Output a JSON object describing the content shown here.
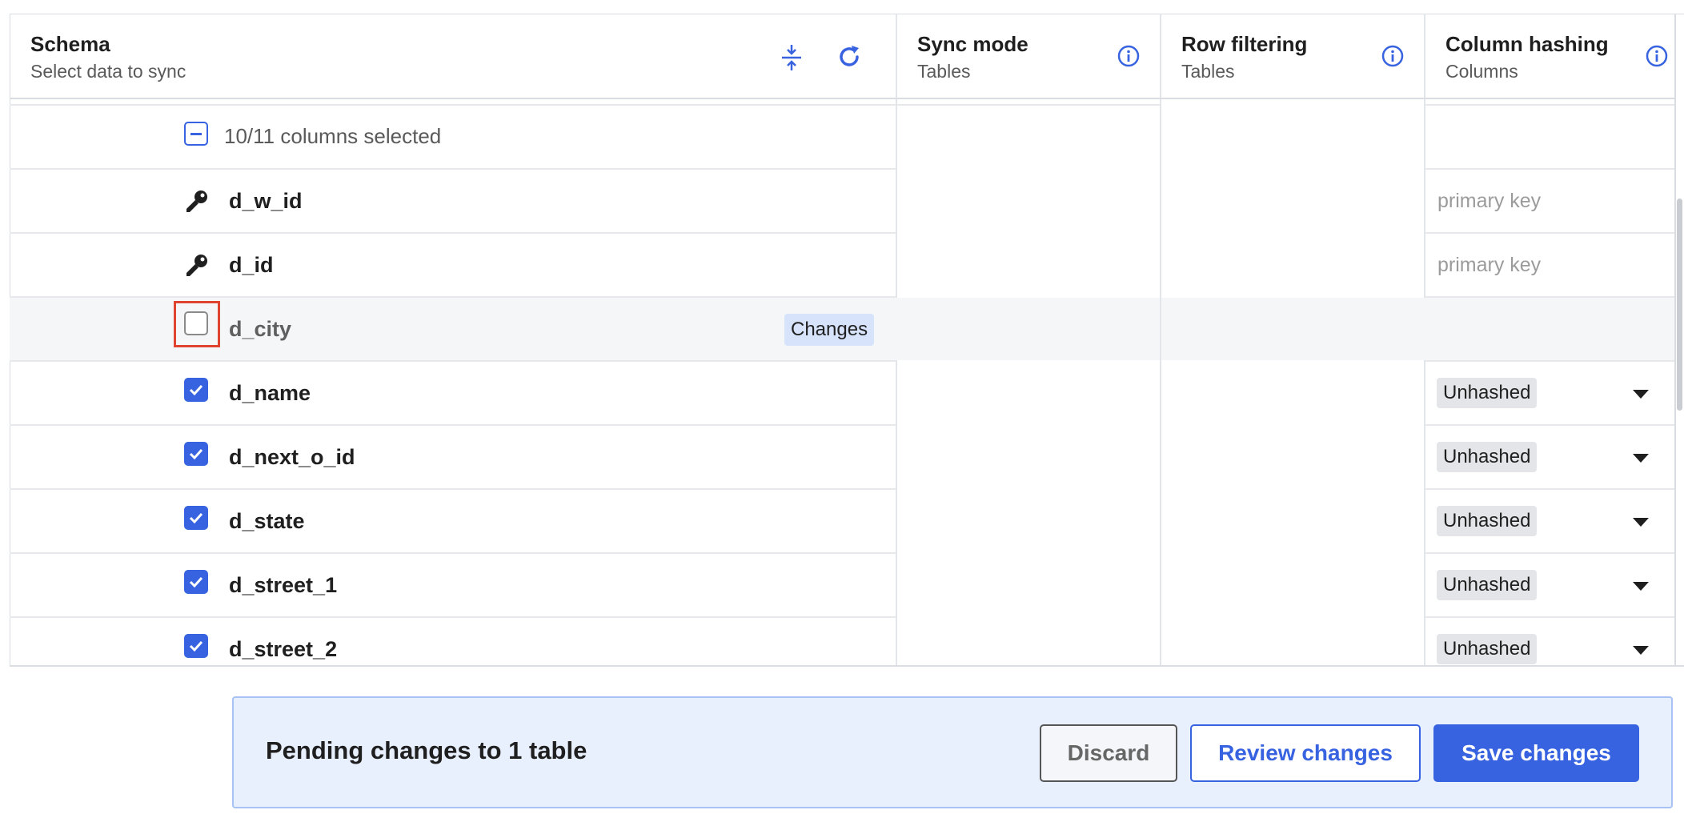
{
  "header": {
    "schema": {
      "title": "Schema",
      "subtitle": "Select data to sync"
    },
    "sync_mode": {
      "title": "Sync mode",
      "subtitle": "Tables"
    },
    "row_filtering": {
      "title": "Row filtering",
      "subtitle": "Tables"
    },
    "column_hashing": {
      "title": "Column hashing",
      "subtitle": "Columns"
    }
  },
  "summary": {
    "label": "10/11 columns selected"
  },
  "rows": [
    {
      "name": "d_w_id",
      "state": "key",
      "hashing": "primary key"
    },
    {
      "name": "d_id",
      "state": "key",
      "hashing": "primary key"
    },
    {
      "name": "d_city",
      "state": "unchecked",
      "badge": "Changes",
      "hashing": ""
    },
    {
      "name": "d_name",
      "state": "checked",
      "hashing": "Unhashed"
    },
    {
      "name": "d_next_o_id",
      "state": "checked",
      "hashing": "Unhashed"
    },
    {
      "name": "d_state",
      "state": "checked",
      "hashing": "Unhashed"
    },
    {
      "name": "d_street_1",
      "state": "checked",
      "hashing": "Unhashed"
    },
    {
      "name": "d_street_2",
      "state": "checked",
      "hashing": "Unhashed"
    }
  ],
  "footer": {
    "message": "Pending changes to 1 table",
    "discard_label": "Discard",
    "review_label": "Review changes",
    "save_label": "Save changes"
  },
  "colors": {
    "accent": "#3863e0",
    "highlight_outline": "#e0432f",
    "footer_bg": "#e8effd",
    "badge_bg": "#d6e3fb"
  }
}
